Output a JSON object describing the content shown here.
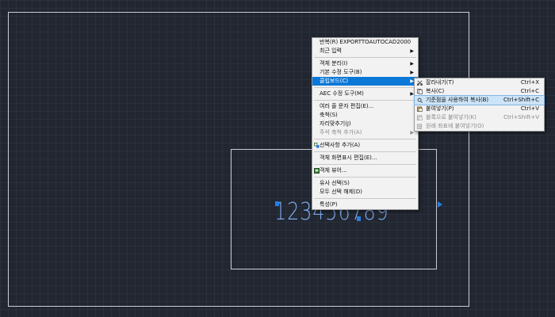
{
  "context_menu": {
    "items": [
      {
        "label": "반복(R) EXPORTTOAUTOCAD2000"
      },
      {
        "label": "최근 입력",
        "submenu": true
      },
      {
        "separator": true
      },
      {
        "label": "객체 분리(I)",
        "submenu": true
      },
      {
        "label": "기본 수정 도구(B)",
        "submenu": true
      },
      {
        "label": "클립보드(C)",
        "submenu": true,
        "highlighted": true
      },
      {
        "separator": true
      },
      {
        "label": "AEC 수정 도구(M)",
        "submenu": true
      },
      {
        "separator": true
      },
      {
        "label": "여러 줄 문자 편집(E)..."
      },
      {
        "label": "축척(S)"
      },
      {
        "label": "자리맞추기(J)"
      },
      {
        "label": "주석 축척 추가(A)",
        "submenu": true,
        "disabled": true
      },
      {
        "separator": true
      },
      {
        "label": "선택사항 추가(A)",
        "icon": "add-selection-icon"
      },
      {
        "separator": true
      },
      {
        "label": "객체 화면표시 편집(E)..."
      },
      {
        "separator": true
      },
      {
        "label": "객체 뷰어...",
        "icon": "object-viewer-icon"
      },
      {
        "separator": true
      },
      {
        "label": "유사 선택(S)"
      },
      {
        "label": "모두 선택 해제(D)"
      },
      {
        "separator": true
      },
      {
        "label": "특성(P)"
      }
    ]
  },
  "clipboard_submenu": {
    "items": [
      {
        "label": "잘라내기(T)",
        "shortcut": "Ctrl+X",
        "icon": "cut-icon"
      },
      {
        "label": "복사(C)",
        "shortcut": "Ctrl+C",
        "icon": "copy-icon"
      },
      {
        "label": "기준점을 사용하여 복사(B)",
        "shortcut": "Ctrl+Shift+C",
        "icon": "copy-basepoint-icon",
        "hovered": true
      },
      {
        "label": "붙여넣기(P)",
        "shortcut": "Ctrl+V",
        "icon": "paste-icon"
      },
      {
        "label": "블록으로 붙여넣기(K)",
        "shortcut": "Ctrl+Shift+V",
        "icon": "paste-block-icon",
        "disabled": true
      },
      {
        "label": "원래 좌표에 붙여넣기(O)",
        "icon": "paste-original-icon",
        "disabled": true
      }
    ]
  },
  "drawing": {
    "text_entity": "123456789"
  },
  "colors": {
    "menu_highlight": "#0a78d7",
    "grip": "#2a7de1",
    "text_entity": "#7ea9ee"
  }
}
